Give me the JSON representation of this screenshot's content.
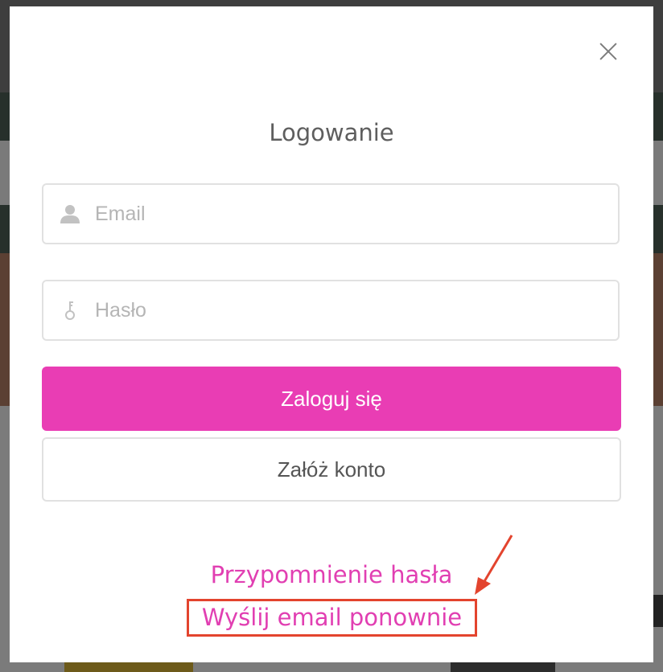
{
  "modal": {
    "title": "Logowanie",
    "email": {
      "placeholder": "Email",
      "icon": "user-icon"
    },
    "password": {
      "placeholder": "Hasło",
      "icon": "key-icon"
    },
    "login_button": "Zaloguj się",
    "register_button": "Załóż konto",
    "forgot_password_link": "Przypomnienie hasła",
    "resend_email_link": "Wyślij email ponownie"
  },
  "colors": {
    "accent": "#e93db4",
    "link": "#e13fb2",
    "highlight": "#e3442e"
  }
}
